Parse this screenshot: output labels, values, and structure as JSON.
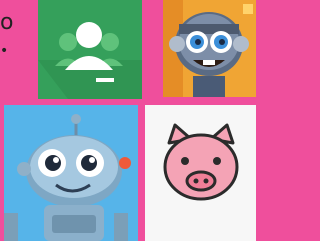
{
  "partial_text": {
    "letter": "o",
    "dot": "•"
  },
  "tiles": [
    {
      "name": "google-classroom-icon",
      "bg": "#35a05b"
    },
    {
      "name": "robot-avatar-icon",
      "bg": "#f0a534"
    },
    {
      "name": "blue-robot-avatar-icon",
      "bg": "#56b4e9"
    },
    {
      "name": "pig-avatar-icon",
      "bg": "#f7f7f7"
    }
  ],
  "colors": {
    "page_bg": "#ef4f9c",
    "pig_pink": "#f4a3b5"
  }
}
